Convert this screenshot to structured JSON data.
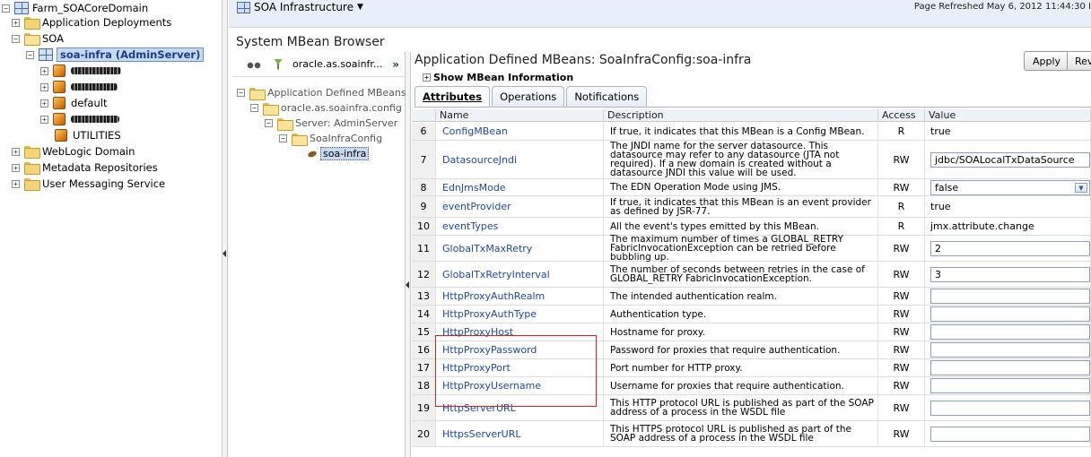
{
  "left_nav": {
    "items": [
      {
        "label": "Farm_SOACoreDomain",
        "icon": "farm-icon"
      },
      {
        "label": "Application Deployments",
        "icon": "folder-icon"
      },
      {
        "label": "SOA",
        "icon": "folder-icon"
      },
      {
        "label": "soa-infra (AdminServer)",
        "icon": "soa-server-icon"
      },
      {
        "label": "default",
        "icon": "partition-icon"
      },
      {
        "label": "UTILITIES",
        "icon": "partition-icon"
      },
      {
        "label": "WebLogic Domain",
        "icon": "folder-icon"
      },
      {
        "label": "Metadata Repositories",
        "icon": "folder-icon"
      },
      {
        "label": "User Messaging Service",
        "icon": "folder-icon"
      }
    ]
  },
  "topbar": {
    "title": "SOA Infrastructure",
    "refreshed": "Page Refreshed May 6, 2012 11:44:30 I"
  },
  "page_title": "System MBean Browser",
  "mbean_tree": {
    "path": "oracle.as.soainfr...",
    "nodes": [
      "Application Defined MBeans",
      "oracle.as.soainfra.config",
      "Server: AdminServer",
      "SoaInfraConfig",
      "soa-infra"
    ]
  },
  "content": {
    "title": "Application Defined MBeans: SoaInfraConfig:soa-infra",
    "apply_label": "Apply",
    "revert_label": "Rev",
    "show_info": "Show MBean Information",
    "tabs": [
      "Attributes",
      "Operations",
      "Notifications"
    ],
    "columns": [
      "Name",
      "Description",
      "Access",
      "Value"
    ],
    "rows": [
      {
        "num": "6",
        "name": "ConfigMBean",
        "desc": "If true, it indicates that this MBean is a Config MBean.",
        "access": "R",
        "value": "true",
        "type": "text"
      },
      {
        "num": "7",
        "name": "DatasourceJndi",
        "desc": "The JNDI name for the server datasource. This datasource may refer to any datasource (JTA not required). If a new domain is created without a datasource JNDI this value will be used.",
        "access": "RW",
        "value": "jdbc/SOALocalTxDataSource",
        "type": "input"
      },
      {
        "num": "8",
        "name": "EdnJmsMode",
        "desc": "The EDN Operation Mode using JMS.",
        "access": "RW",
        "value": "false",
        "type": "select"
      },
      {
        "num": "9",
        "name": "eventProvider",
        "desc": "If true, it indicates that this MBean is an event provider as defined by JSR-77.",
        "access": "R",
        "value": "true",
        "type": "text"
      },
      {
        "num": "10",
        "name": "eventTypes",
        "desc": "All the event's types emitted by this MBean.",
        "access": "R",
        "value": "jmx.attribute.change",
        "type": "text"
      },
      {
        "num": "11",
        "name": "GlobalTxMaxRetry",
        "desc": "The maximum number of times a GLOBAL_RETRY FabricInvocationException can be retried before bubbling up.",
        "access": "RW",
        "value": "2",
        "type": "input"
      },
      {
        "num": "12",
        "name": "GlobalTxRetryInterval",
        "desc": "The number of seconds between retries in the case of GLOBAL_RETRY FabricInvocationException.",
        "access": "RW",
        "value": "3",
        "type": "input"
      },
      {
        "num": "13",
        "name": "HttpProxyAuthRealm",
        "desc": "The intended authentication realm.",
        "access": "RW",
        "value": "",
        "type": "input"
      },
      {
        "num": "14",
        "name": "HttpProxyAuthType",
        "desc": "Authentication type.",
        "access": "RW",
        "value": "",
        "type": "input"
      },
      {
        "num": "15",
        "name": "HttpProxyHost",
        "desc": "Hostname for proxy.",
        "access": "RW",
        "value": "",
        "type": "input"
      },
      {
        "num": "16",
        "name": "HttpProxyPassword",
        "desc": "Password for proxies that require authentication.",
        "access": "RW",
        "value": "",
        "type": "input"
      },
      {
        "num": "17",
        "name": "HttpProxyPort",
        "desc": "Port number for HTTP proxy.",
        "access": "RW",
        "value": "",
        "type": "input"
      },
      {
        "num": "18",
        "name": "HttpProxyUsername",
        "desc": "Username for proxies that require authentication.",
        "access": "RW",
        "value": "",
        "type": "input"
      },
      {
        "num": "19",
        "name": "HttpServerURL",
        "desc": "This HTTP protocol URL is published as part of the SOAP address of a process in the WSDL file",
        "access": "RW",
        "value": "",
        "type": "input"
      },
      {
        "num": "20",
        "name": "HttpsServerURL",
        "desc": "This HTTPS protocol URL is published as part of the SOAP address of a process in the WSDL file",
        "access": "RW",
        "value": "",
        "type": "input"
      }
    ]
  }
}
